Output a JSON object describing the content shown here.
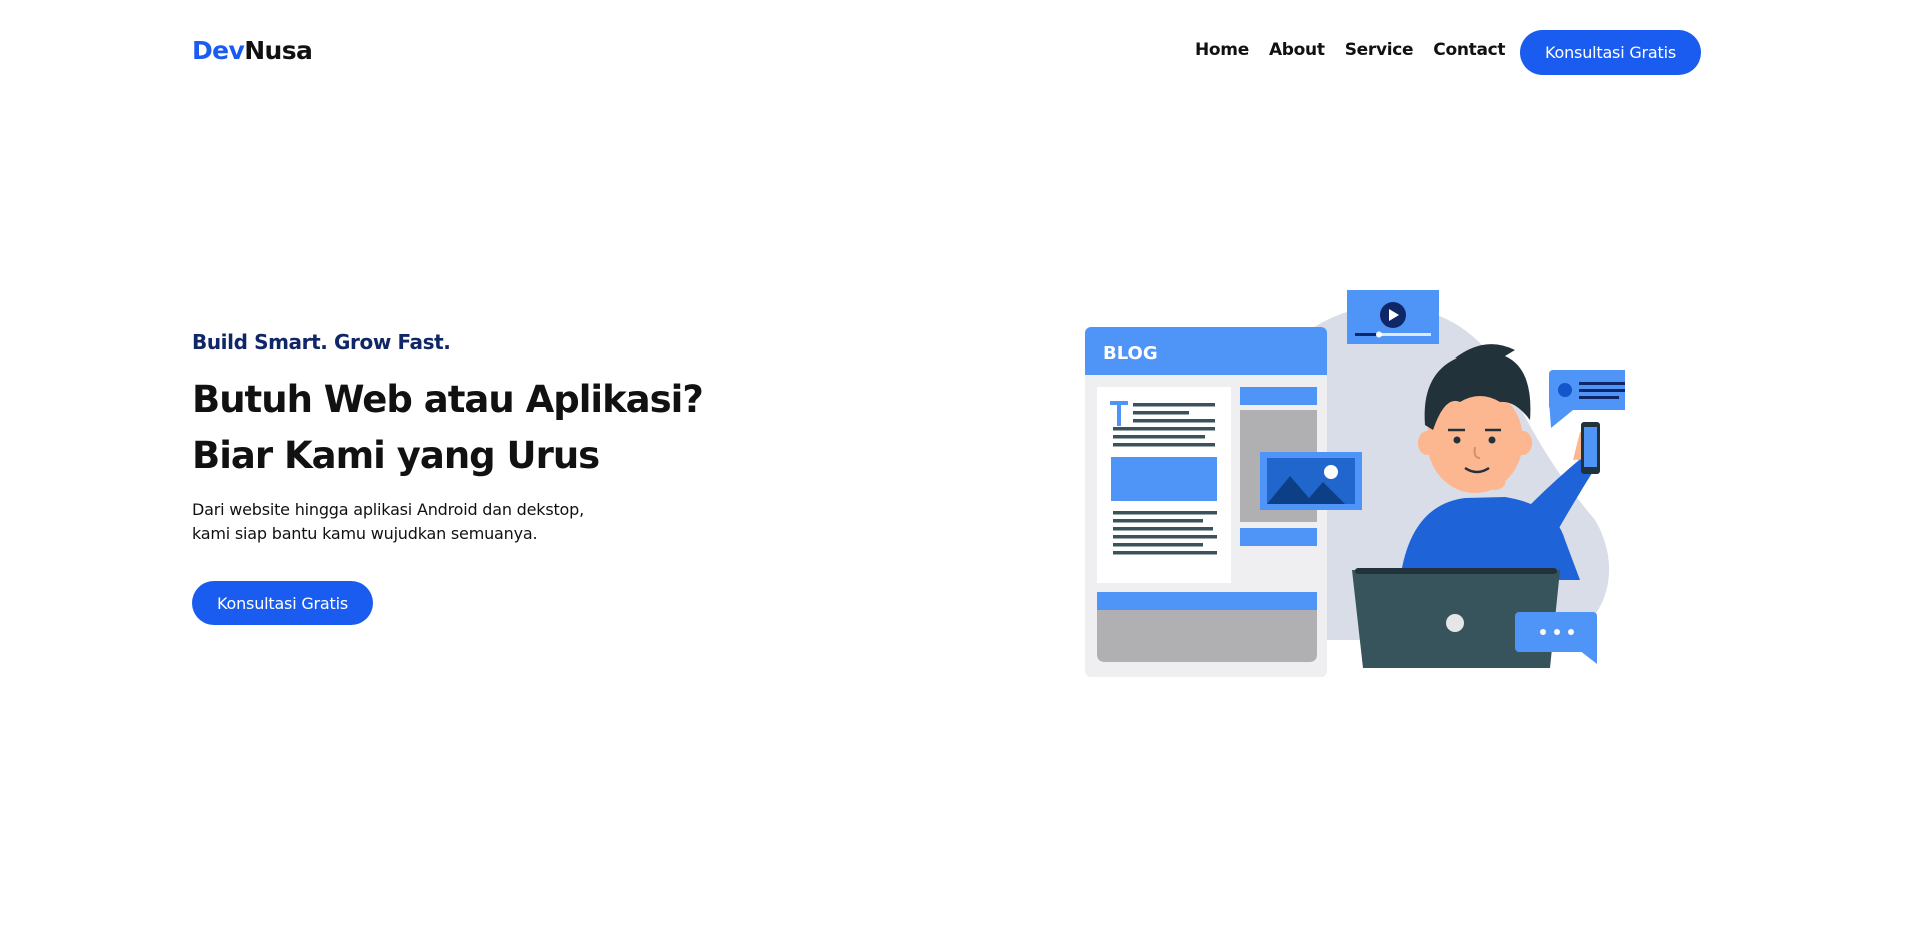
{
  "brand": {
    "part1": "Dev",
    "part2": "Nusa"
  },
  "nav": {
    "links": [
      {
        "label": "Home"
      },
      {
        "label": "About"
      },
      {
        "label": "Service"
      },
      {
        "label": "Contact"
      }
    ],
    "cta_label": "Konsultasi Gratis"
  },
  "hero": {
    "tagline": "Build Smart. Grow Fast.",
    "headline_line1": "Butuh Web atau Aplikasi?",
    "headline_line2": "Biar Kami yang Urus",
    "subtext_line1": "Dari website hingga aplikasi Android dan dekstop,",
    "subtext_line2": "kami siap bantu kamu wujudkan semuanya.",
    "cta_label": "Konsultasi Gratis"
  },
  "illustration": {
    "blog_label": "BLOG",
    "icon": "person-laptop-blog-illustration"
  },
  "colors": {
    "accent": "#1a5cf0",
    "tagline": "#0f2766",
    "illustration_blue": "#4f95f8",
    "laptop": "#37535c"
  }
}
